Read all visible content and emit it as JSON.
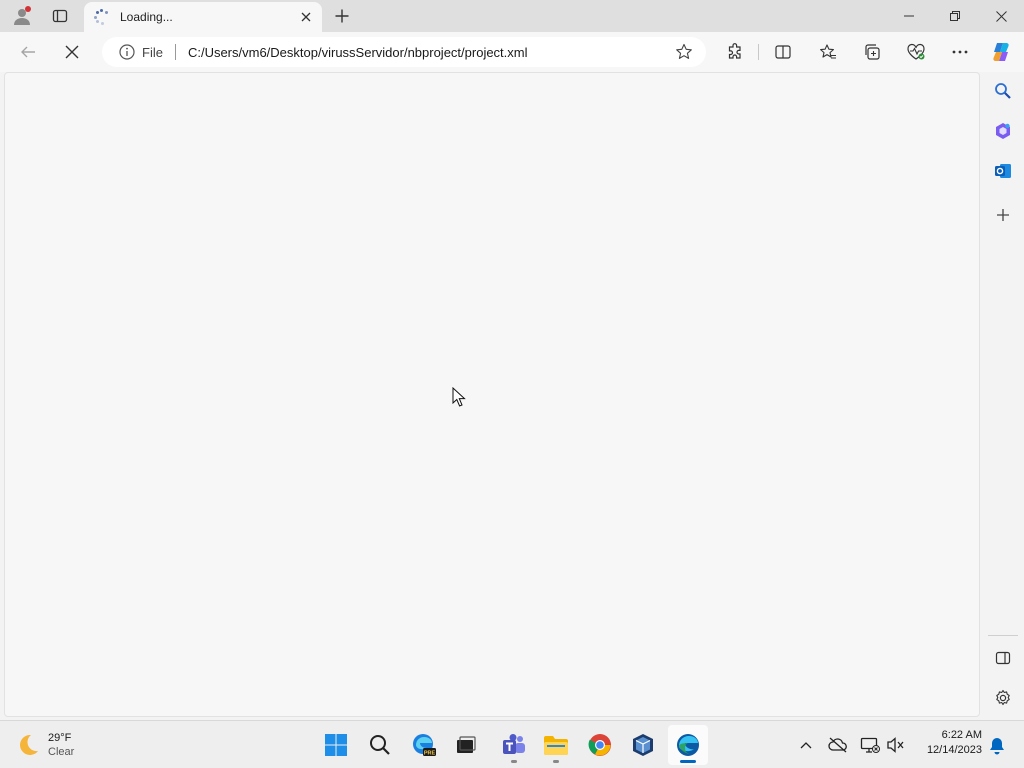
{
  "browser": {
    "tab": {
      "title": "Loading..."
    },
    "address_bar": {
      "scheme_label": "File",
      "url": "C:/Users/vm6/Desktop/virussServidor/nbproject/project.xml"
    },
    "toolbar_icons": [
      "back-icon",
      "stop-icon",
      "info-icon",
      "favorite-star-icon",
      "extensions-icon",
      "split-screen-icon",
      "favorites-icon",
      "collections-icon",
      "browser-essentials-icon",
      "more-icon",
      "copilot-icon"
    ],
    "sidebar_icons": [
      "search-icon",
      "copilot-sidebar-icon",
      "outlook-icon",
      "add-icon",
      "hide-sidebar-icon",
      "settings-icon"
    ]
  },
  "taskbar": {
    "weather": {
      "temp": "29°F",
      "condition": "Clear"
    },
    "apps": [
      "start-icon",
      "search-icon",
      "edge-beta-icon",
      "task-view-icon",
      "teams-icon",
      "file-explorer-icon",
      "chrome-icon",
      "virtualbox-icon",
      "edge-icon"
    ],
    "clock": {
      "time": "6:22 AM",
      "date": "12/14/2023"
    }
  },
  "colors": {
    "accent": "#0067c0",
    "tabstrip": "#dfdfdf",
    "content_bg": "#f7f7f7"
  }
}
